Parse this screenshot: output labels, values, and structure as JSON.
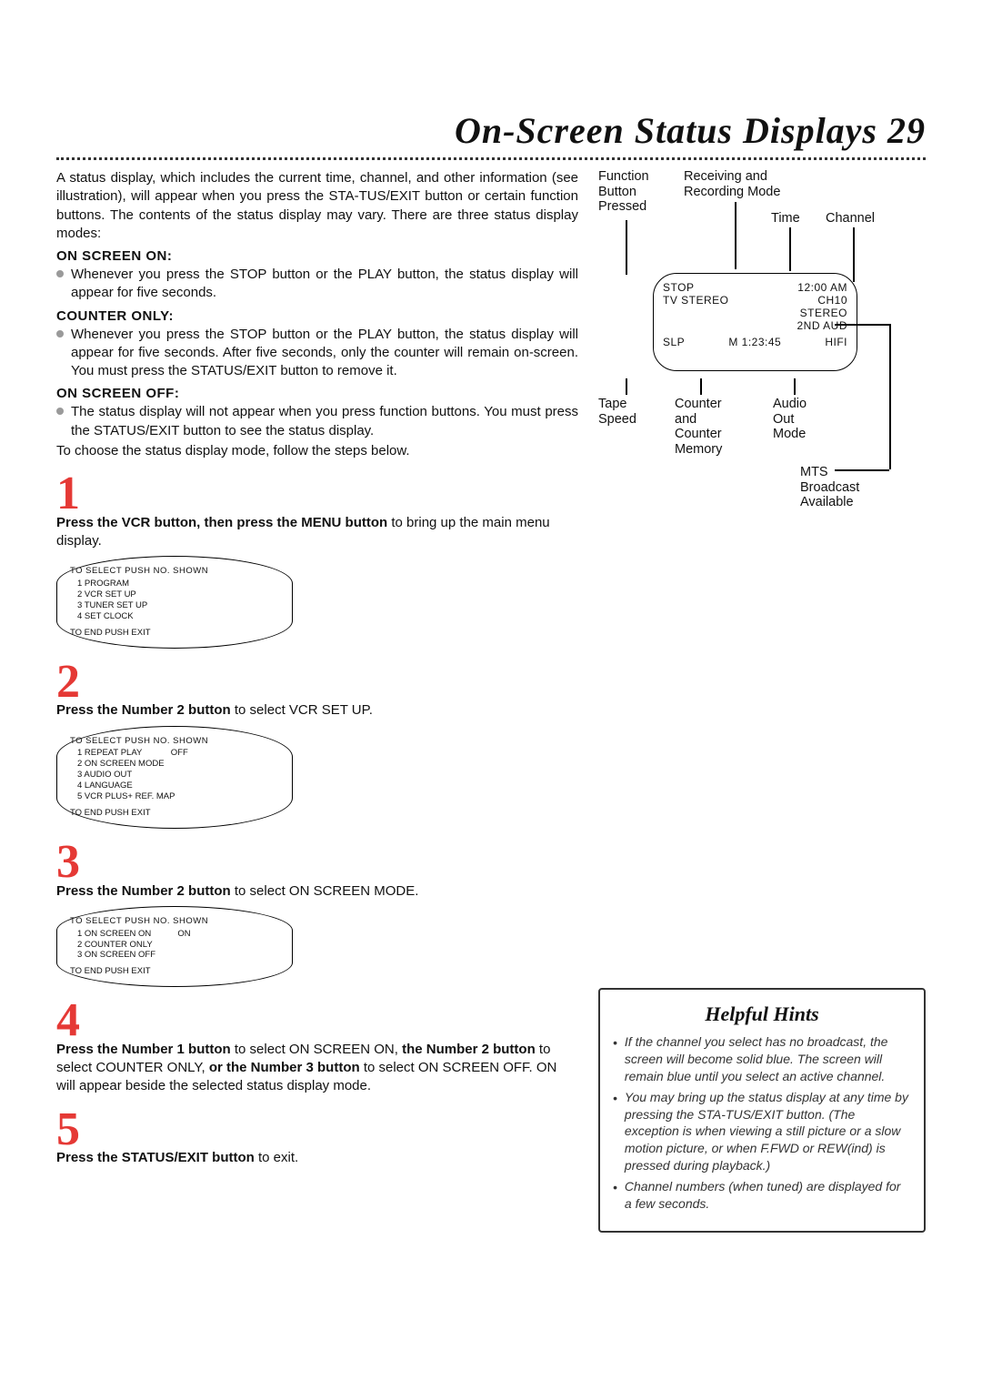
{
  "page": {
    "title": "On-Screen Status Displays 29"
  },
  "intro": "A status display, which includes the current time, channel, and other information (see illustration), will appear when you press the STA-TUS/EXIT button or certain function buttons. The contents of the status display may vary. There are three status display modes:",
  "modes": {
    "on_h": "ON SCREEN ON:",
    "on_b": "Whenever you press the STOP button or the PLAY button, the status display will appear for five seconds.",
    "counter_h": "COUNTER ONLY:",
    "counter_b": "Whenever you press the STOP button or the PLAY button, the status display will appear for five seconds. After five seconds, only the counter will remain on-screen. You must press the STATUS/EXIT button to remove it.",
    "off_h": "ON SCREEN OFF:",
    "off_b": "The status display will not appear when you press function buttons. You must press the STATUS/EXIT button to see the status display.",
    "choose": "To choose the status display mode, follow the steps below."
  },
  "steps": {
    "s1_num": "1",
    "s1_a": "Press the VCR button, then press the MENU button",
    "s1_b": " to bring up the main menu display.",
    "s2_num": "2",
    "s2_a": "Press the Number 2 button",
    "s2_b": " to select VCR SET UP.",
    "s3_num": "3",
    "s3_a": "Press the Number 2 button",
    "s3_b": " to select ON SCREEN MODE.",
    "s4_num": "4",
    "s4_a": "Press the Number 1 button",
    "s4_b": " to select ON SCREEN ON,",
    "s4_c": " the Number 2 button",
    "s4_d": " to select COUNTER ONLY,",
    "s4_e": " or the Number 3 button",
    "s4_f": " to select ON SCREEN OFF. ON will appear beside the selected status display mode.",
    "s5_num": "5",
    "s5_a": "Press the STATUS/EXIT button",
    "s5_b": " to exit."
  },
  "menus": {
    "m1_title": "TO SELECT PUSH NO. SHOWN",
    "m1_items": [
      "1 PROGRAM",
      "2 VCR SET UP",
      "3 TUNER SET UP",
      "4 SET CLOCK"
    ],
    "m1_foot": "TO END PUSH EXIT",
    "m2_title": "TO SELECT PUSH NO. SHOWN",
    "m2_items": [
      "1 REPEAT PLAY            OFF",
      "2 ON SCREEN MODE",
      "3 AUDIO OUT",
      "4 LANGUAGE",
      "5 VCR PLUS+ REF. MAP"
    ],
    "m2_foot": "TO END PUSH EXIT",
    "m3_title": "TO SELECT PUSH NO. SHOWN",
    "m3_items": [
      "1 ON SCREEN ON           ON",
      "2 COUNTER ONLY",
      "3 ON SCREEN OFF"
    ],
    "m3_foot": "TO END PUSH EXIT"
  },
  "status": {
    "labels": {
      "func": "Function\nButton\nPressed",
      "recv": "Receiving and\nRecording Mode",
      "time": "Time",
      "channel": "Channel",
      "tape_speed": "Tape\nSpeed",
      "counter": "Counter\nand\nCounter\nMemory",
      "audio": "Audio\nOut\nMode",
      "mts": "MTS\nBroadcast\nAvailable"
    },
    "screen": {
      "l1a": "STOP",
      "l1b": "12:00 AM",
      "l2a": "TV STEREO",
      "l2b": "CH10",
      "l3": "STEREO",
      "l4": "2ND AUD",
      "l5a": "SLP",
      "l5b": "M 1:23:45",
      "l5c": "HIFI"
    }
  },
  "hints": {
    "title": "Helpful Hints",
    "items": [
      "If the channel you select has no broadcast, the screen will become solid blue. The screen will remain blue until you select an active channel.",
      "You may bring up the status display at any time by pressing the STA-TUS/EXIT button. (The exception is when viewing a still picture or a slow motion picture, or when F.FWD or REW(ind) is pressed during playback.)",
      "Channel numbers (when tuned) are displayed for a few seconds."
    ]
  }
}
